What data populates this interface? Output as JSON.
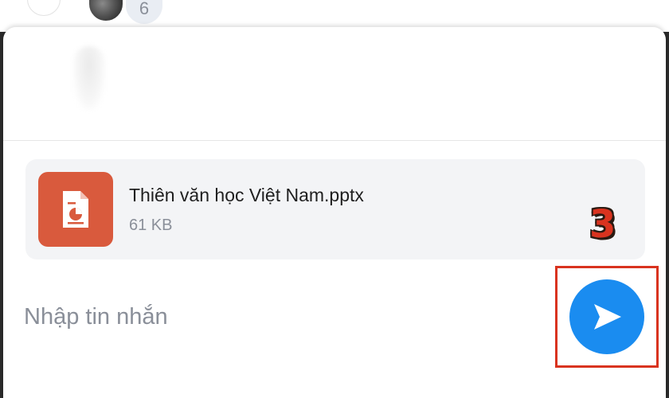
{
  "background_chat": {
    "member_count": "6"
  },
  "attachment": {
    "file_name": "Thiên văn học Việt Nam.pptx",
    "file_size": "61 KB",
    "icon": "powerpoint-file-icon",
    "icon_color": "#d95a3d"
  },
  "composer": {
    "placeholder": "Nhập tin nhắn",
    "value": "",
    "send_icon": "send-icon",
    "send_color": "#1a8cf0"
  },
  "annotation": {
    "step": "3",
    "color": "#d9331f"
  }
}
